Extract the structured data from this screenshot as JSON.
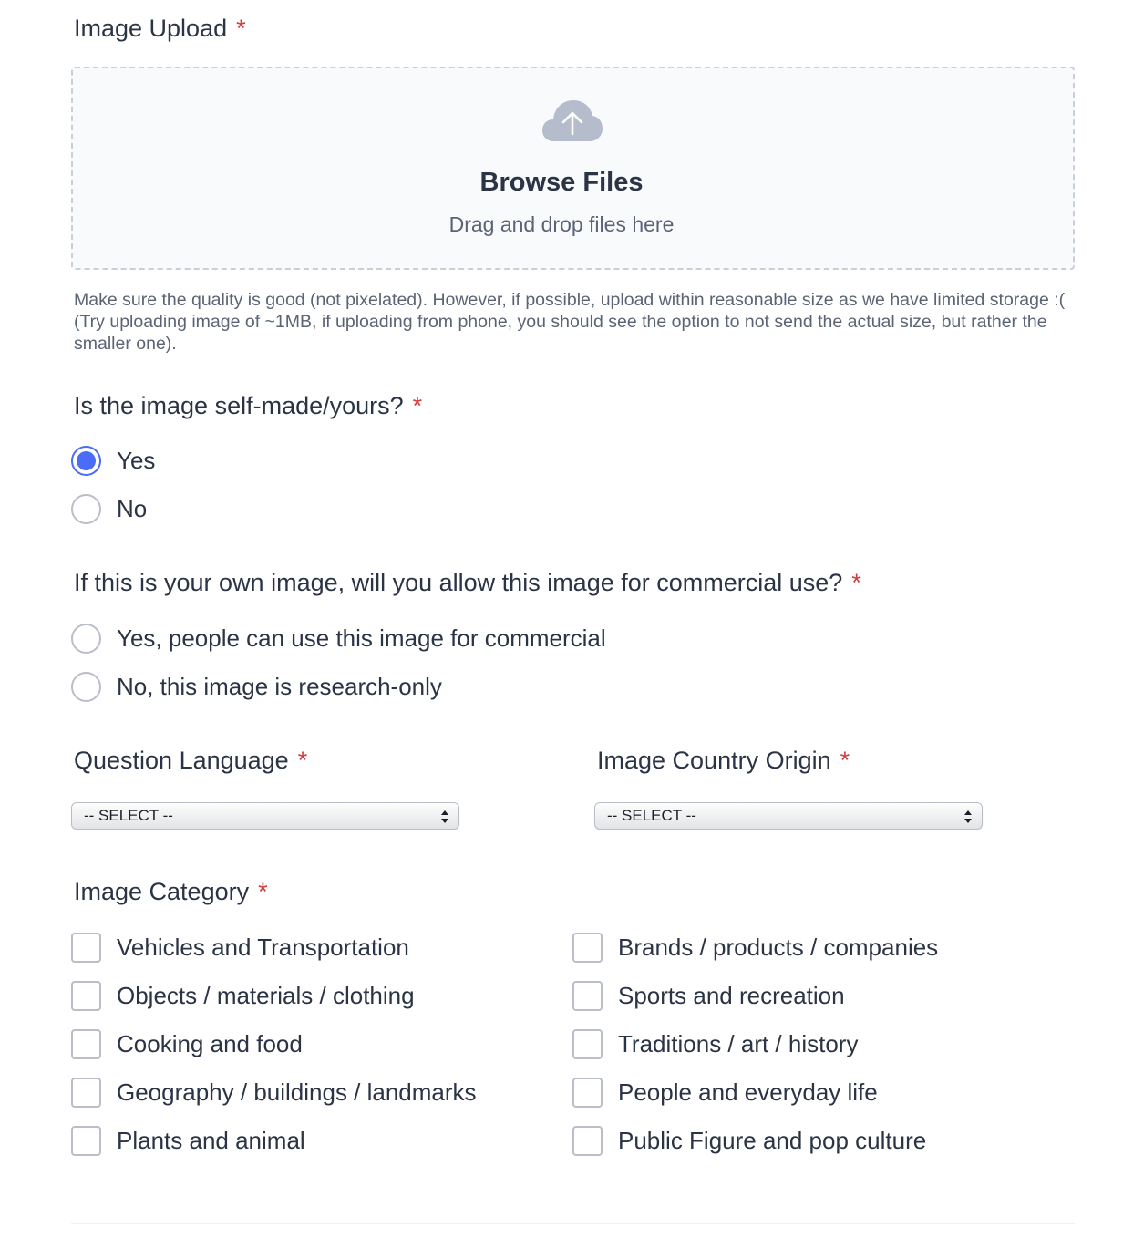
{
  "upload": {
    "label": "Image Upload",
    "required_mark": "*",
    "icon": "cloud-upload-icon",
    "browse_label": "Browse Files",
    "drag_text": "Drag and drop files here",
    "help_text": "Make sure the quality is good (not pixelated). However, if possible, upload within reasonable size as we have limited storage :( (Try uploading image of ~1MB, if uploading from phone, you should see the option to not send the actual size, but rather the smaller one)."
  },
  "self_made": {
    "label": "Is the image self-made/yours?",
    "required_mark": "*",
    "options": [
      {
        "label": "Yes",
        "checked": true
      },
      {
        "label": "No",
        "checked": false
      }
    ]
  },
  "commercial": {
    "label": "If this is your own image, will you allow this image for commercial use?",
    "required_mark": "*",
    "options": [
      {
        "label": "Yes, people can use this image for commercial",
        "checked": false
      },
      {
        "label": "No, this image is research-only",
        "checked": false
      }
    ]
  },
  "language": {
    "label": "Question Language",
    "required_mark": "*",
    "selected": "-- SELECT --"
  },
  "country": {
    "label": "Image Country Origin",
    "required_mark": "*",
    "selected": "-- SELECT --"
  },
  "category": {
    "label": "Image Category",
    "required_mark": "*",
    "left": [
      "Vehicles and Transportation",
      "Objects / materials / clothing",
      "Cooking and food",
      "Geography / buildings / landmarks",
      "Plants and animal"
    ],
    "right": [
      "Brands / products / companies",
      "Sports and recreation",
      "Traditions / art / history",
      "People and everyday life",
      "Public Figure and pop culture"
    ]
  },
  "colors": {
    "accent": "#4a6cf7",
    "required": "#d23b3b",
    "text": "#2b3445",
    "muted": "#5b6475"
  }
}
